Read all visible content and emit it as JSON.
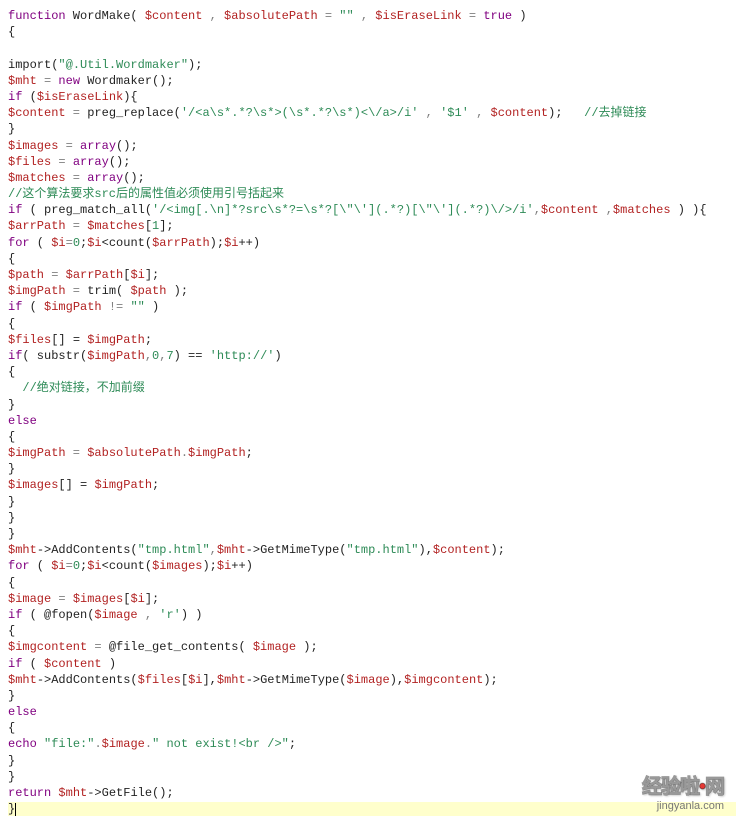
{
  "code": {
    "l1_kw1": "function",
    "l1_fn": " WordMake( ",
    "l1_v1": "$content",
    "l1_op1": " , ",
    "l1_v2": "$absolutePath",
    "l1_op2": " = ",
    "l1_s1": "\"\"",
    "l1_op3": " , ",
    "l1_v3": "$isEraseLink",
    "l1_op4": " = ",
    "l1_kw2": "true",
    "l1_cp": " )",
    "l2": "{",
    "l3": "",
    "l4_a": "import(",
    "l4_s": "\"@.Util.Wordmaker\"",
    "l4_b": ");",
    "l5_v": "$mht",
    "l5_eq": " = ",
    "l5_kw": "new",
    "l5_r": " Wordmaker();",
    "l6_kw": "if",
    "l6_a": " (",
    "l6_v": "$isEraseLink",
    "l6_b": "){",
    "l7_v1": "$content",
    "l7_eq": " = ",
    "l7_fn": "preg_replace(",
    "l7_s1": "'/<a\\s*.*?\\s*>(\\s*.*?\\s*)<\\/a>/i'",
    "l7_c1": " , ",
    "l7_s2": "'$1'",
    "l7_c2": " , ",
    "l7_v2": "$content",
    "l7_cp": ");   ",
    "l7_cmt": "//去掉链接",
    "l8": "}",
    "l9_v": "$images",
    "l9_eq": " = ",
    "l9_kw": "array",
    "l9_r": "();",
    "l10_v": "$files",
    "l10_eq": " = ",
    "l10_kw": "array",
    "l10_r": "();",
    "l11_v": "$matches",
    "l11_eq": " = ",
    "l11_kw": "array",
    "l11_r": "();",
    "l12_cmt": "//这个算法要求src后的属性值必须使用引号括起来",
    "l13_kw": "if",
    "l13_a": " ( preg_match_all(",
    "l13_s": "'/<img[.\\n]*?src\\s*?=\\s*?[\\\"\\'](.*?)[\\\"\\'](.*?)\\/>/i'",
    "l13_c": ",",
    "l13_v1": "$content",
    "l13_c2": " ,",
    "l13_v2": "$matches",
    "l13_cp": " ) ){",
    "l14_v1": "$arrPath",
    "l14_eq": " = ",
    "l14_v2": "$matches",
    "l14_idx": "[",
    "l14_n": "1",
    "l14_r": "];",
    "l15_kw": "for",
    "l15_a": " ( ",
    "l15_v1": "$i",
    "l15_eq": "=",
    "l15_n0": "0",
    "l15_sc": ";",
    "l15_v2": "$i",
    "l15_lt": "<count(",
    "l15_v3": "$arrPath",
    "l15_cp": ");",
    "l15_v4": "$i",
    "l15_inc": "++)",
    "l16": "{",
    "l17_v1": "$path",
    "l17_eq": " = ",
    "l17_v2": "$arrPath",
    "l17_a": "[",
    "l17_v3": "$i",
    "l17_b": "];",
    "l18_v1": "$imgPath",
    "l18_eq": " = ",
    "l18_fn": "trim( ",
    "l18_v2": "$path",
    "l18_cp": " );",
    "l19_kw": "if",
    "l19_a": " ( ",
    "l19_v": "$imgPath",
    "l19_ne": " != ",
    "l19_s": "\"\"",
    "l19_cp": " )",
    "l20": "{",
    "l21_v1": "$files",
    "l21_a": "[] = ",
    "l21_v2": "$imgPath",
    "l21_sc": ";",
    "l22_kw": "if",
    "l22_a": "( substr(",
    "l22_v": "$imgPath",
    "l22_c": ",",
    "l22_n1": "0",
    "l22_c2": ",",
    "l22_n2": "7",
    "l22_cp": ") == ",
    "l22_s": "'http://'",
    "l22_cp2": ")",
    "l23": "{",
    "l24_cmt": "  //绝对链接，不加前缀",
    "l25": "}",
    "l26_kw": "else",
    "l27": "{",
    "l28_v1": "$imgPath",
    "l28_eq": " = ",
    "l28_v2": "$absolutePath",
    "l28_d": ".",
    "l28_v3": "$imgPath",
    "l28_sc": ";",
    "l29": "}",
    "l30_v1": "$images",
    "l30_a": "[] = ",
    "l30_v2": "$imgPath",
    "l30_sc": ";",
    "l31": "}",
    "l32": "}",
    "l33": "}",
    "l34_v": "$mht",
    "l34_ar": "->AddContents(",
    "l34_s1": "\"tmp.html\"",
    "l34_c": ",",
    "l34_v2": "$mht",
    "l34_ar2": "->GetMimeType(",
    "l34_s2": "\"tmp.html\"",
    "l34_cp": "),",
    "l34_v3": "$content",
    "l34_cp2": ");",
    "l35_kw": "for",
    "l35_a": " ( ",
    "l35_v1": "$i",
    "l35_eq": "=",
    "l35_n0": "0",
    "l35_sc": ";",
    "l35_v2": "$i",
    "l35_lt": "<count(",
    "l35_v3": "$images",
    "l35_cp": ");",
    "l35_v4": "$i",
    "l35_inc": "++)",
    "l36": "{",
    "l37_v1": "$image",
    "l37_eq": " = ",
    "l37_v2": "$images",
    "l37_a": "[",
    "l37_v3": "$i",
    "l37_b": "];",
    "l38_kw": "if",
    "l38_a": " ( @fopen(",
    "l38_v": "$image",
    "l38_c": " , ",
    "l38_s": "'r'",
    "l38_cp": ") )",
    "l39": "{",
    "l40_v1": "$imgcontent",
    "l40_eq": " = ",
    "l40_fn": "@file_get_contents( ",
    "l40_v2": "$image",
    "l40_cp": " );",
    "l41_kw": "if",
    "l41_a": " ( ",
    "l41_v": "$content",
    "l41_cp": " )",
    "l42_v": "$mht",
    "l42_ar": "->AddContents(",
    "l42_v2": "$files",
    "l42_a": "[",
    "l42_v3": "$i",
    "l42_b": "],",
    "l42_v4": "$mht",
    "l42_ar2": "->GetMimeType(",
    "l42_v5": "$image",
    "l42_cp": "),",
    "l42_v6": "$imgcontent",
    "l42_cp2": ");",
    "l43": "}",
    "l44_kw": "else",
    "l45": "{",
    "l46_kw": "echo",
    "l46_sp": " ",
    "l46_s1": "\"file:\"",
    "l46_d": ".",
    "l46_v": "$image",
    "l46_d2": ".",
    "l46_s2": "\" not exist!<br />\"",
    "l46_sc": ";",
    "l47": "}",
    "l48": "}",
    "l49_kw": "return",
    "l49_sp": " ",
    "l49_v": "$mht",
    "l49_r": "->GetFile();",
    "l50": "}"
  },
  "watermark": {
    "brand_pre": "经验啦",
    "brand_dot": "•",
    "brand_post": "网",
    "domain": "jingyanla.com"
  }
}
